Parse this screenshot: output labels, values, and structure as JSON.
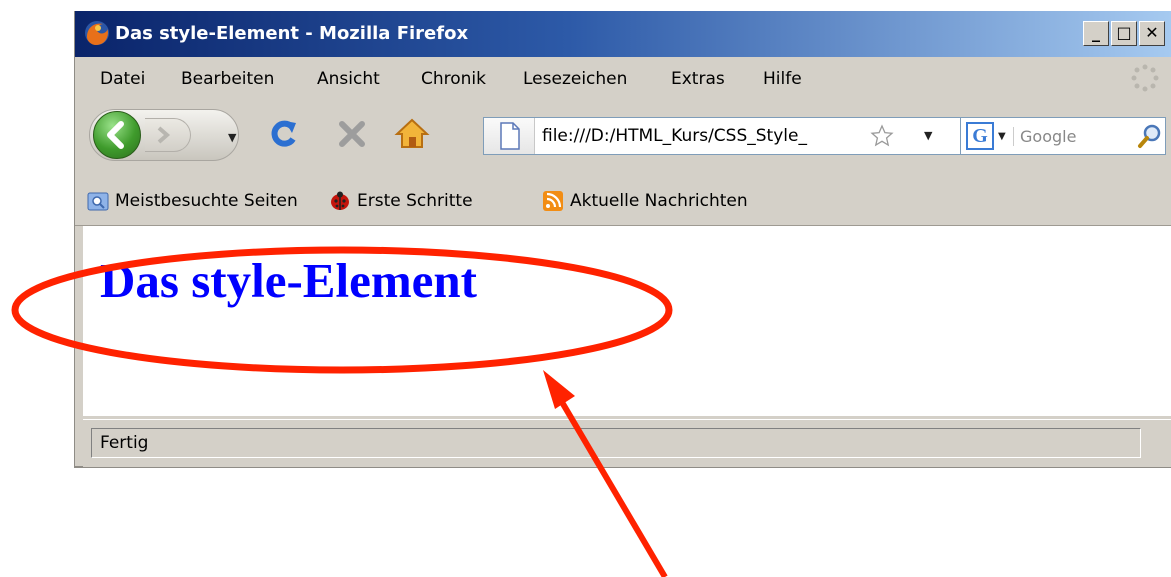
{
  "window": {
    "title": "Das style-Element - Mozilla Firefox",
    "minimize_label": "_",
    "maximize_label": "□",
    "close_label": "✕"
  },
  "menubar": {
    "items": [
      "Datei",
      "Bearbeiten",
      "Ansicht",
      "Chronik",
      "Lesezeichen",
      "Extras",
      "Hilfe"
    ]
  },
  "navbar": {
    "url": "file:///D:/HTML_Kurs/CSS_Style_",
    "search_placeholder": "Google",
    "search_engine_letter": "G"
  },
  "bookmarks": {
    "items": [
      {
        "label": "Meistbesuchte Seiten",
        "icon": "search-folder-icon"
      },
      {
        "label": "Erste Schritte",
        "icon": "firefox-ladybug-icon"
      },
      {
        "label": "Aktuelle Nachrichten",
        "icon": "rss-feed-icon"
      }
    ]
  },
  "page": {
    "heading": "Das style-Element"
  },
  "status": {
    "text": "Fertig"
  },
  "colors": {
    "heading": "#0000ff",
    "annotation": "#ff2200",
    "titlebar_start": "#0a246a"
  }
}
